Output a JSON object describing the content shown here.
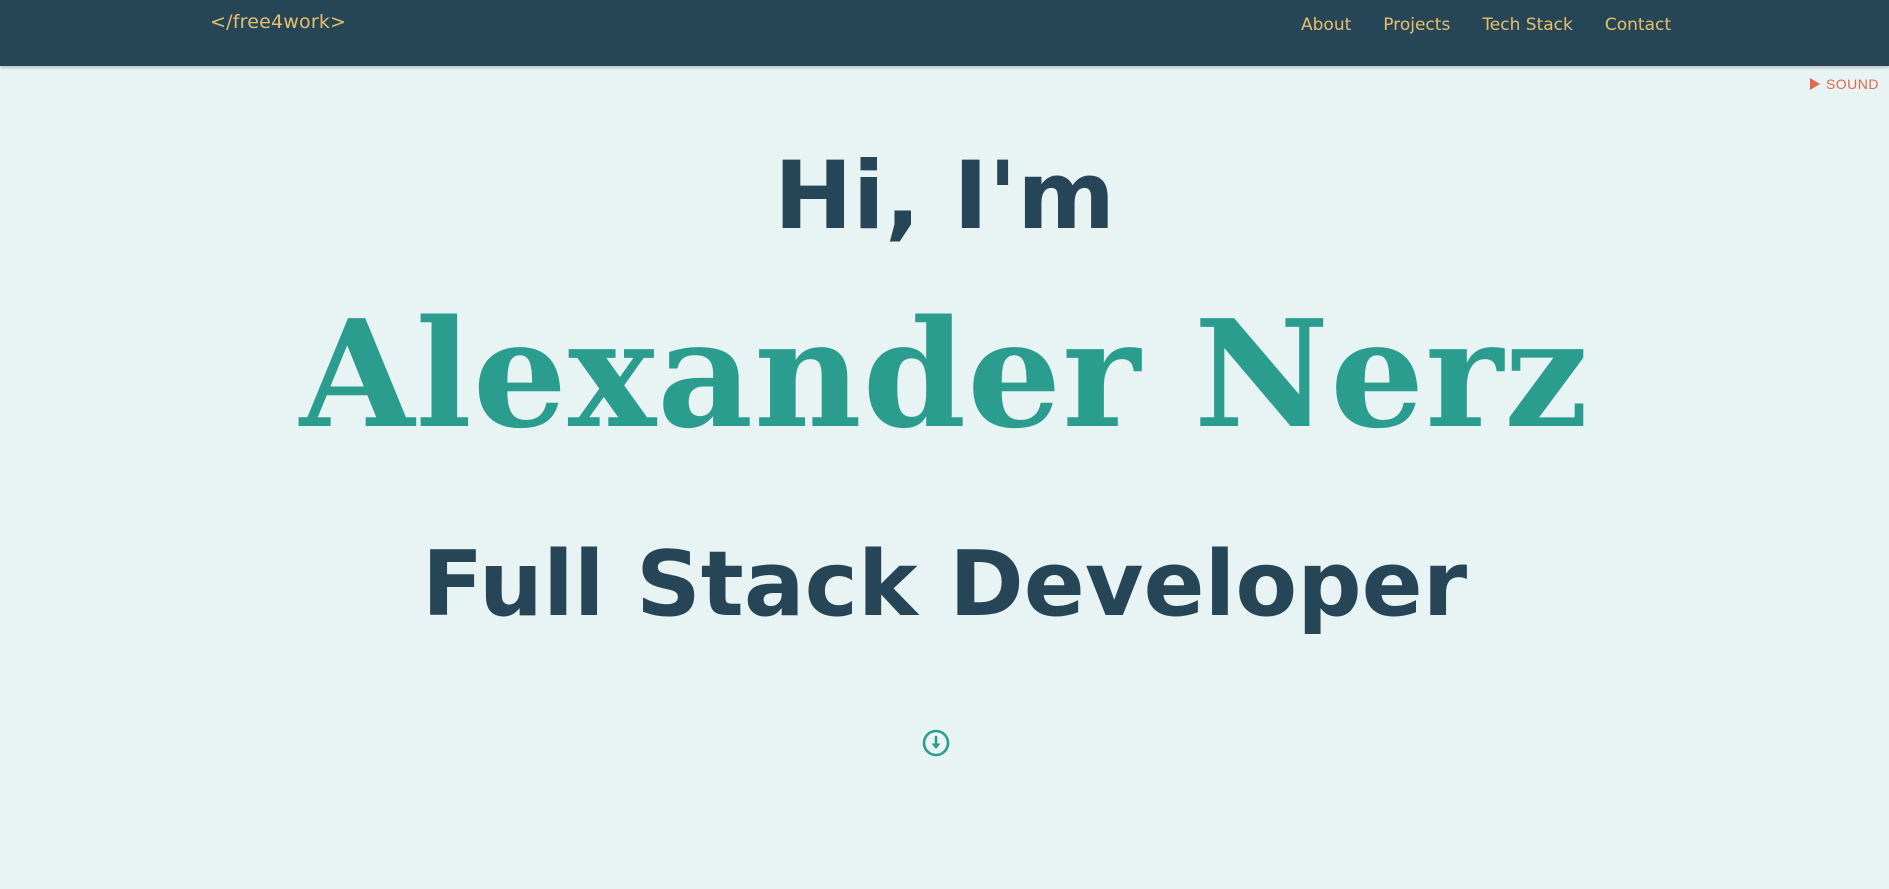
{
  "header": {
    "logo": "</free4work>",
    "nav": [
      "About",
      "Projects",
      "Tech Stack",
      "Contact"
    ]
  },
  "sound": {
    "label": "SOUND",
    "icon": "play-icon"
  },
  "hero": {
    "greeting": "Hi, I'm",
    "name": "Alexander Nerz",
    "role": "Full Stack Developer",
    "scroll_icon": "arrow-down-circle-icon"
  },
  "colors": {
    "header_bg": "#264556",
    "page_bg": "#e8f3f3",
    "accent_gold": "#e4c06b",
    "accent_teal": "#2a9d8f",
    "sound_red": "#e1684b",
    "text_dark": "#264556"
  }
}
